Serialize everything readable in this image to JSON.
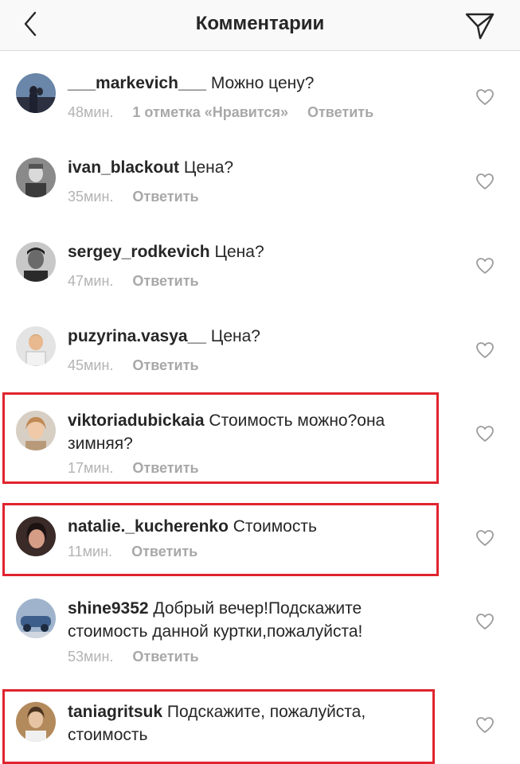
{
  "header": {
    "title": "Комментарии",
    "back_icon": "chevron-left-icon",
    "send_icon": "paper-plane-icon"
  },
  "comments": [
    {
      "username": "___markevich___",
      "text": "Можно  цену?",
      "time": "48мин.",
      "likes": "1 отметка «Нравится»",
      "reply": "Ответить",
      "highlighted": false
    },
    {
      "username": "ivan_blackout",
      "text": "Цена?",
      "time": "35мин.",
      "reply": "Ответить",
      "highlighted": false
    },
    {
      "username": "sergey_rodkevich",
      "text": "Цена?",
      "time": "47мин.",
      "reply": "Ответить",
      "highlighted": false
    },
    {
      "username": "puzyrina.vasya__",
      "text": "Цена?",
      "time": "45мин.",
      "reply": "Ответить",
      "highlighted": false
    },
    {
      "username": "viktoriadubickaia",
      "text": "Стоимость можно?она зимняя?",
      "time": "17мин.",
      "reply": "Ответить",
      "highlighted": true
    },
    {
      "username": "natalie._kucherenko",
      "text": "Стоимость",
      "time": "11мин.",
      "reply": "Ответить",
      "highlighted": true
    },
    {
      "username": "shine9352",
      "text": "Добрый вечер!Подскажите стоимость данной куртки,пожалуйста!",
      "time": "53мин.",
      "reply": "Ответить",
      "highlighted": false
    },
    {
      "username": "taniagritsuk",
      "text": "Подскажите, пожалуйста, стоимость",
      "highlighted": true
    }
  ],
  "colors": {
    "highlight_border": "#e0242e",
    "meta_text": "#a8a8a8",
    "header_bg": "#f9f9f9"
  }
}
